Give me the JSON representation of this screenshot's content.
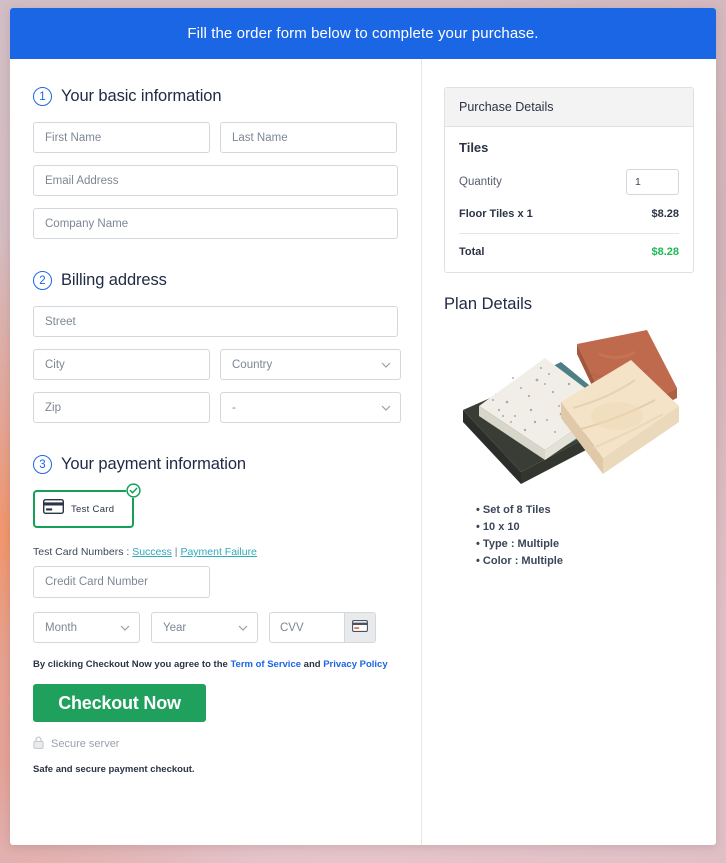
{
  "banner": {
    "text": "Fill the order form below to complete your purchase."
  },
  "sections": {
    "basic": {
      "number": "1",
      "title": "Your basic information",
      "fields": {
        "first_name": "First Name",
        "last_name": "Last Name",
        "email": "Email Address",
        "company": "Company Name"
      }
    },
    "billing": {
      "number": "2",
      "title": "Billing address",
      "fields": {
        "street": "Street",
        "city": "City",
        "country": "Country",
        "zip": "Zip",
        "state": "-"
      }
    },
    "payment": {
      "number": "3",
      "title": "Your payment information",
      "card_option_label": "Test  Card",
      "test_numbers_label": "Test Card Numbers : ",
      "test_success_link": "Success",
      "test_separator": " | ",
      "test_failure_link": "Payment Failure",
      "credit_card_placeholder": "Credit Card Number",
      "month_placeholder": "Month",
      "year_placeholder": "Year",
      "cvv_placeholder": "CVV",
      "terms_prefix": "By clicking Checkout Now you agree to the ",
      "terms_link1": "Term of Service",
      "terms_middle": " and ",
      "terms_link2": "Privacy Policy",
      "checkout_label": "Checkout Now",
      "secure_server_label": "Secure server",
      "safe_note": "Safe and secure payment checkout."
    }
  },
  "purchase_details": {
    "header": "Purchase Details",
    "product_title": "Tiles",
    "quantity_label": "Quantity",
    "quantity_value": "1",
    "line_item_label": "Floor Tiles x 1",
    "line_item_price": "$8.28",
    "total_label": "Total",
    "total_price": "$8.28"
  },
  "plan_details": {
    "title": "Plan Details",
    "features": [
      "Set of 8 Tiles",
      "10 x 10",
      "Type : Multiple",
      "Color : Multiple"
    ]
  },
  "colors": {
    "banner_blue": "#1b66e5",
    "accent_blue": "#1b66e5",
    "checkout_green": "#1fa05d",
    "card_border_green": "#15a05a",
    "total_green": "#21b757",
    "link_teal": "#2fabb9"
  },
  "icons": {
    "card": "credit-card-icon",
    "check_badge": "check-circle-icon",
    "lock": "lock-icon",
    "chevron": "chevron-down-icon"
  }
}
